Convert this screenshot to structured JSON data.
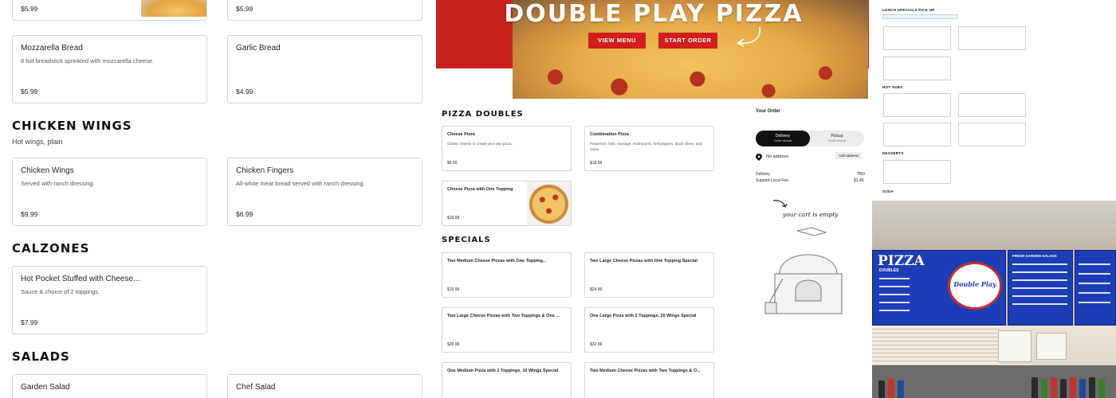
{
  "menu": {
    "top_prices": [
      "$5.99",
      "$5.99"
    ],
    "items_top": [
      {
        "name": "Mozzarella Bread",
        "desc": "8 hot breadstick sprinkled with mozzarella cheese.",
        "price": "$5.99"
      },
      {
        "name": "Garlic Bread",
        "desc": "",
        "price": "$4.99"
      }
    ],
    "chicken_wings": {
      "title": "CHICKEN WINGS",
      "subtitle": "Hot wings, plain",
      "items": [
        {
          "name": "Chicken Wings",
          "desc": "Served with ranch dressing.",
          "price": "$9.99"
        },
        {
          "name": "Chicken Fingers",
          "desc": "All-white meat bread served with ranch dressing.",
          "price": "$6.99"
        }
      ]
    },
    "calzones": {
      "title": "CALZONES",
      "items": [
        {
          "name": "Hot Pocket Stuffed with Cheese...",
          "desc": "Sauce & choice of 2 toppings.",
          "price": "$7.99"
        }
      ]
    },
    "salads": {
      "title": "SALADS",
      "items": [
        {
          "name": "Garden Salad"
        },
        {
          "name": "Chef Salad"
        }
      ]
    }
  },
  "hero": {
    "title": "DOUBLE PLAY PIZZA",
    "view_menu": "VIEW MENU",
    "start_order": "START ORDER",
    "accent": "#c9211e"
  },
  "doubles": {
    "title": "PIZZA DOUBLES",
    "items": [
      {
        "name": "Cheese Pizza",
        "desc": "Classic cheese or create your own pizza.",
        "price": "$6.50"
      },
      {
        "name": "Combination Pizza",
        "desc": "Pepperoni, ham, sausage, mushrooms, bell peppers, black olives, and onion.",
        "price": "$18.99"
      },
      {
        "name": "Cheese Pizza with One Topping",
        "desc": "",
        "price": "$19.99"
      }
    ]
  },
  "specials": {
    "title": "SPECIALS",
    "items": [
      {
        "name": "Two Medium Cheese Pizzas with One Topping...",
        "price": "$19.99"
      },
      {
        "name": "Two Large Cheese Pizzas with One Topping Special",
        "price": "$24.99"
      },
      {
        "name": "Two Large Cheese Pizzas with Two Toppings & One ...",
        "price": "$28.99"
      },
      {
        "name": "One Large Pizza with 2 Toppings, 20 Wings Special",
        "price": "$32.99"
      },
      {
        "name": "One Medium Pizza with 2 Toppings, 10 Wings Special",
        "price": ""
      },
      {
        "name": "Two Medium Cheese Pizzas with Two Toppings & O...",
        "price": ""
      }
    ]
  },
  "order": {
    "title": "Your Order",
    "delivery": "Delivery",
    "delivery_sub": "Order ahead",
    "pickup": "Pickup",
    "pickup_sub": "Order ahead",
    "no_address": "No address",
    "add_address": "Add address",
    "delivery_label": "Delivery",
    "delivery_value": "TBD",
    "fee_label": "Support Local Fee",
    "fee_value": "$1.49",
    "empty_cart": "your cart is empty"
  },
  "mini_menu": {
    "lunch_title": "LUNCH SPECIALS PICK UP",
    "hot_subs_title": "HOT SUBS",
    "desserts_title": "DESSERTS",
    "soda_title": "SODA"
  },
  "storefront": {
    "board_title": "PIZZA",
    "board_sub": "DOUBLES",
    "salads_title": "FRESH GARDEN SALADS",
    "logo_text": "Double Play"
  }
}
